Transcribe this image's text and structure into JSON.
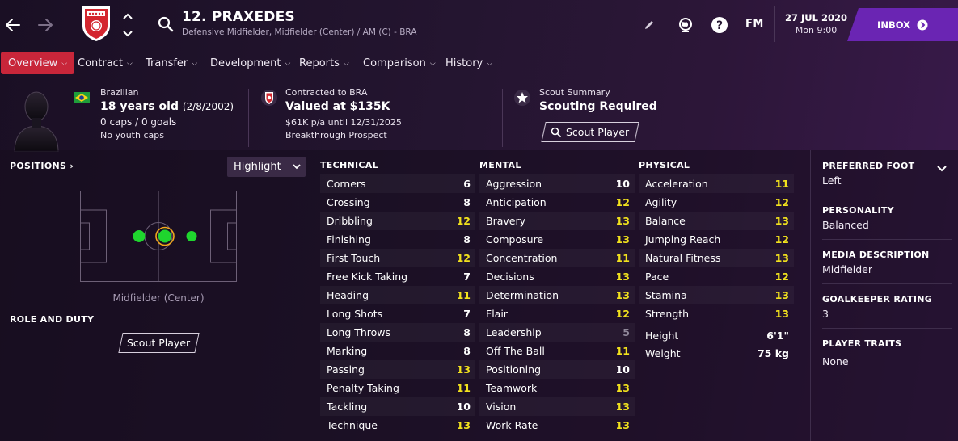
{
  "header": {
    "player_name": "12. PRAXEDES",
    "player_subtitle": "Defensive Midfielder, Midfielder (Center) / AM (C) - BRA",
    "date": "27 JUL 2020",
    "time": "Mon 9:00",
    "fm_label": "FM",
    "inbox_label": "INBOX"
  },
  "tabs": [
    {
      "label": "Overview",
      "active": true
    },
    {
      "label": "Contract"
    },
    {
      "label": "Transfer"
    },
    {
      "label": "Development"
    },
    {
      "label": "Reports"
    },
    {
      "label": "Comparison"
    },
    {
      "label": "History"
    }
  ],
  "info": {
    "nationality": "Brazilian",
    "age": "18 years old",
    "dob": "(2/8/2002)",
    "caps": "0 caps / 0 goals",
    "youth_caps": "No youth caps",
    "contract_club": "Contracted to BRA",
    "value": "Valued at $135K",
    "wage": "$61K p/a until 12/31/2025",
    "prospect": "Breakthrough Prospect",
    "scout_title": "Scout Summary",
    "scout_status": "Scouting Required",
    "scout_button": "Scout Player"
  },
  "left_panel": {
    "positions_title": "POSITIONS",
    "highlight_label": "Highlight",
    "position_label": "Midfielder (Center)",
    "role_title": "ROLE AND DUTY",
    "role_button": "Scout Player"
  },
  "technical": {
    "title": "TECHNICAL",
    "rows": [
      {
        "name": "Corners",
        "value": "6",
        "color": "white"
      },
      {
        "name": "Crossing",
        "value": "8",
        "color": "white"
      },
      {
        "name": "Dribbling",
        "value": "12",
        "color": "yellow"
      },
      {
        "name": "Finishing",
        "value": "8",
        "color": "white"
      },
      {
        "name": "First Touch",
        "value": "12",
        "color": "yellow"
      },
      {
        "name": "Free Kick Taking",
        "value": "7",
        "color": "white"
      },
      {
        "name": "Heading",
        "value": "11",
        "color": "yellow"
      },
      {
        "name": "Long Shots",
        "value": "7",
        "color": "white"
      },
      {
        "name": "Long Throws",
        "value": "8",
        "color": "white"
      },
      {
        "name": "Marking",
        "value": "8",
        "color": "white"
      },
      {
        "name": "Passing",
        "value": "13",
        "color": "yellow"
      },
      {
        "name": "Penalty Taking",
        "value": "11",
        "color": "yellow"
      },
      {
        "name": "Tackling",
        "value": "10",
        "color": "white"
      },
      {
        "name": "Technique",
        "value": "13",
        "color": "yellow"
      }
    ]
  },
  "mental": {
    "title": "MENTAL",
    "rows": [
      {
        "name": "Aggression",
        "value": "10",
        "color": "white"
      },
      {
        "name": "Anticipation",
        "value": "12",
        "color": "yellow"
      },
      {
        "name": "Bravery",
        "value": "13",
        "color": "yellow"
      },
      {
        "name": "Composure",
        "value": "13",
        "color": "yellow"
      },
      {
        "name": "Concentration",
        "value": "11",
        "color": "yellow"
      },
      {
        "name": "Decisions",
        "value": "13",
        "color": "yellow"
      },
      {
        "name": "Determination",
        "value": "13",
        "color": "yellow"
      },
      {
        "name": "Flair",
        "value": "12",
        "color": "yellow"
      },
      {
        "name": "Leadership",
        "value": "5",
        "color": "grey"
      },
      {
        "name": "Off The Ball",
        "value": "11",
        "color": "yellow"
      },
      {
        "name": "Positioning",
        "value": "10",
        "color": "white"
      },
      {
        "name": "Teamwork",
        "value": "13",
        "color": "yellow"
      },
      {
        "name": "Vision",
        "value": "13",
        "color": "yellow"
      },
      {
        "name": "Work Rate",
        "value": "13",
        "color": "yellow"
      }
    ]
  },
  "physical": {
    "title": "PHYSICAL",
    "rows": [
      {
        "name": "Acceleration",
        "value": "11",
        "color": "yellow"
      },
      {
        "name": "Agility",
        "value": "12",
        "color": "yellow"
      },
      {
        "name": "Balance",
        "value": "13",
        "color": "yellow"
      },
      {
        "name": "Jumping Reach",
        "value": "12",
        "color": "yellow"
      },
      {
        "name": "Natural Fitness",
        "value": "13",
        "color": "yellow"
      },
      {
        "name": "Pace",
        "value": "12",
        "color": "yellow"
      },
      {
        "name": "Stamina",
        "value": "13",
        "color": "yellow"
      },
      {
        "name": "Strength",
        "value": "13",
        "color": "yellow"
      }
    ],
    "height_label": "Height",
    "height_value": "6'1\"",
    "weight_label": "Weight",
    "weight_value": "75 kg"
  },
  "right_panel": {
    "foot_title": "PREFERRED FOOT",
    "foot_value": "Left",
    "personality_title": "PERSONALITY",
    "personality_value": "Balanced",
    "media_title": "MEDIA DESCRIPTION",
    "media_value": "Midfielder",
    "gk_title": "GOALKEEPER RATING",
    "gk_value": "3",
    "traits_title": "PLAYER TRAITS",
    "traits_value": "None"
  },
  "colors": {
    "accent_red": "#c8263a",
    "inbox_purple": "#6a25b3",
    "attr_yellow": "#f2e21d",
    "attr_grey": "#8f8799",
    "position_green": "#1fd62e"
  },
  "icons": [
    "back-arrow-icon",
    "forward-arrow-icon",
    "club-crest-icon",
    "chevron-up-icon",
    "chevron-down-icon",
    "search-icon",
    "pencil-icon",
    "globe-icon",
    "help-icon",
    "arrow-right-circle-icon",
    "brazil-flag-icon",
    "contract-badge-icon",
    "star-icon",
    "magnifier-icon"
  ]
}
